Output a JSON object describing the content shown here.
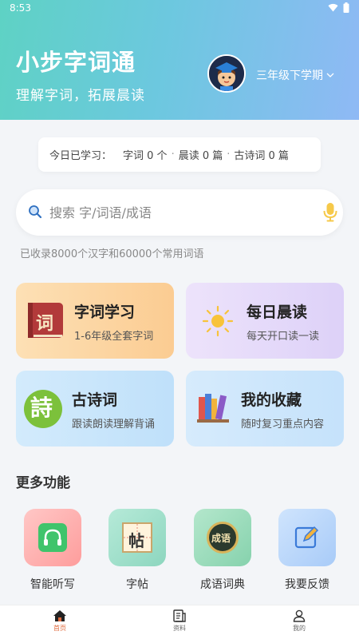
{
  "status": {
    "time": "8:53"
  },
  "header": {
    "title": "小步字词通",
    "subtitle": "理解字词，拓展晨读",
    "grade": "三年级下学期"
  },
  "today": {
    "label": "今日已学习：",
    "words": "字词 0 个",
    "morning": "晨读 0 篇",
    "poems": "古诗词 0 篇",
    "separator": "·"
  },
  "search": {
    "placeholder": "搜索 字/词语/成语",
    "value": "",
    "tip": "已收录8000个汉字和60000个常用词语"
  },
  "cards": [
    {
      "title": "字词学习",
      "desc": "1-6年级全套字词",
      "icon_char": "词"
    },
    {
      "title": "每日晨读",
      "desc": "每天开口读一读"
    },
    {
      "title": "古诗词",
      "desc": "跟读朗读理解背诵",
      "icon_char": "詩"
    },
    {
      "title": "我的收藏",
      "desc": "随时复习重点内容"
    }
  ],
  "more": {
    "title": "更多功能",
    "items": [
      {
        "label": "智能听写",
        "icon": "headphones-icon"
      },
      {
        "label": "字帖",
        "icon": "copybook-icon",
        "icon_char": "帖"
      },
      {
        "label": "成语词典",
        "icon": "idiom-dictionary-icon",
        "icon_char": "成语"
      },
      {
        "label": "我要反馈",
        "icon": "feedback-icon"
      }
    ]
  },
  "tabbar": [
    {
      "label": "首页",
      "active": true
    },
    {
      "label": "资料",
      "active": false
    },
    {
      "label": "我的",
      "active": false
    }
  ],
  "colors": {
    "accent_active_tab": "#e06a3c",
    "header_start": "#5ed2c4",
    "header_end": "#8fb9f5"
  }
}
